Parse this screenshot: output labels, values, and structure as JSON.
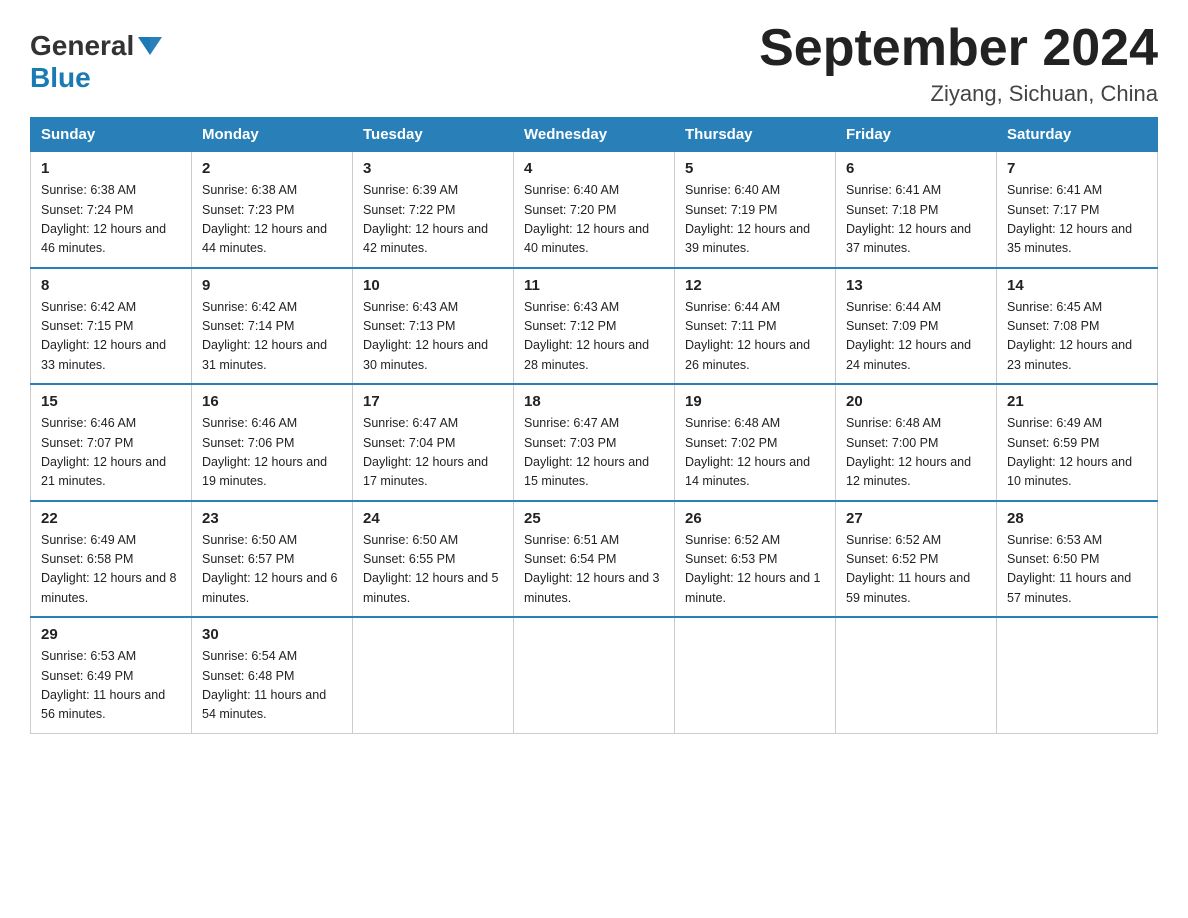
{
  "header": {
    "logo_general": "General",
    "logo_blue": "Blue",
    "month_title": "September 2024",
    "location": "Ziyang, Sichuan, China"
  },
  "weekdays": [
    "Sunday",
    "Monday",
    "Tuesday",
    "Wednesday",
    "Thursday",
    "Friday",
    "Saturday"
  ],
  "weeks": [
    [
      {
        "day": "1",
        "sunrise": "6:38 AM",
        "sunset": "7:24 PM",
        "daylight": "12 hours and 46 minutes."
      },
      {
        "day": "2",
        "sunrise": "6:38 AM",
        "sunset": "7:23 PM",
        "daylight": "12 hours and 44 minutes."
      },
      {
        "day": "3",
        "sunrise": "6:39 AM",
        "sunset": "7:22 PM",
        "daylight": "12 hours and 42 minutes."
      },
      {
        "day": "4",
        "sunrise": "6:40 AM",
        "sunset": "7:20 PM",
        "daylight": "12 hours and 40 minutes."
      },
      {
        "day": "5",
        "sunrise": "6:40 AM",
        "sunset": "7:19 PM",
        "daylight": "12 hours and 39 minutes."
      },
      {
        "day": "6",
        "sunrise": "6:41 AM",
        "sunset": "7:18 PM",
        "daylight": "12 hours and 37 minutes."
      },
      {
        "day": "7",
        "sunrise": "6:41 AM",
        "sunset": "7:17 PM",
        "daylight": "12 hours and 35 minutes."
      }
    ],
    [
      {
        "day": "8",
        "sunrise": "6:42 AM",
        "sunset": "7:15 PM",
        "daylight": "12 hours and 33 minutes."
      },
      {
        "day": "9",
        "sunrise": "6:42 AM",
        "sunset": "7:14 PM",
        "daylight": "12 hours and 31 minutes."
      },
      {
        "day": "10",
        "sunrise": "6:43 AM",
        "sunset": "7:13 PM",
        "daylight": "12 hours and 30 minutes."
      },
      {
        "day": "11",
        "sunrise": "6:43 AM",
        "sunset": "7:12 PM",
        "daylight": "12 hours and 28 minutes."
      },
      {
        "day": "12",
        "sunrise": "6:44 AM",
        "sunset": "7:11 PM",
        "daylight": "12 hours and 26 minutes."
      },
      {
        "day": "13",
        "sunrise": "6:44 AM",
        "sunset": "7:09 PM",
        "daylight": "12 hours and 24 minutes."
      },
      {
        "day": "14",
        "sunrise": "6:45 AM",
        "sunset": "7:08 PM",
        "daylight": "12 hours and 23 minutes."
      }
    ],
    [
      {
        "day": "15",
        "sunrise": "6:46 AM",
        "sunset": "7:07 PM",
        "daylight": "12 hours and 21 minutes."
      },
      {
        "day": "16",
        "sunrise": "6:46 AM",
        "sunset": "7:06 PM",
        "daylight": "12 hours and 19 minutes."
      },
      {
        "day": "17",
        "sunrise": "6:47 AM",
        "sunset": "7:04 PM",
        "daylight": "12 hours and 17 minutes."
      },
      {
        "day": "18",
        "sunrise": "6:47 AM",
        "sunset": "7:03 PM",
        "daylight": "12 hours and 15 minutes."
      },
      {
        "day": "19",
        "sunrise": "6:48 AM",
        "sunset": "7:02 PM",
        "daylight": "12 hours and 14 minutes."
      },
      {
        "day": "20",
        "sunrise": "6:48 AM",
        "sunset": "7:00 PM",
        "daylight": "12 hours and 12 minutes."
      },
      {
        "day": "21",
        "sunrise": "6:49 AM",
        "sunset": "6:59 PM",
        "daylight": "12 hours and 10 minutes."
      }
    ],
    [
      {
        "day": "22",
        "sunrise": "6:49 AM",
        "sunset": "6:58 PM",
        "daylight": "12 hours and 8 minutes."
      },
      {
        "day": "23",
        "sunrise": "6:50 AM",
        "sunset": "6:57 PM",
        "daylight": "12 hours and 6 minutes."
      },
      {
        "day": "24",
        "sunrise": "6:50 AM",
        "sunset": "6:55 PM",
        "daylight": "12 hours and 5 minutes."
      },
      {
        "day": "25",
        "sunrise": "6:51 AM",
        "sunset": "6:54 PM",
        "daylight": "12 hours and 3 minutes."
      },
      {
        "day": "26",
        "sunrise": "6:52 AM",
        "sunset": "6:53 PM",
        "daylight": "12 hours and 1 minute."
      },
      {
        "day": "27",
        "sunrise": "6:52 AM",
        "sunset": "6:52 PM",
        "daylight": "11 hours and 59 minutes."
      },
      {
        "day": "28",
        "sunrise": "6:53 AM",
        "sunset": "6:50 PM",
        "daylight": "11 hours and 57 minutes."
      }
    ],
    [
      {
        "day": "29",
        "sunrise": "6:53 AM",
        "sunset": "6:49 PM",
        "daylight": "11 hours and 56 minutes."
      },
      {
        "day": "30",
        "sunrise": "6:54 AM",
        "sunset": "6:48 PM",
        "daylight": "11 hours and 54 minutes."
      },
      null,
      null,
      null,
      null,
      null
    ]
  ]
}
